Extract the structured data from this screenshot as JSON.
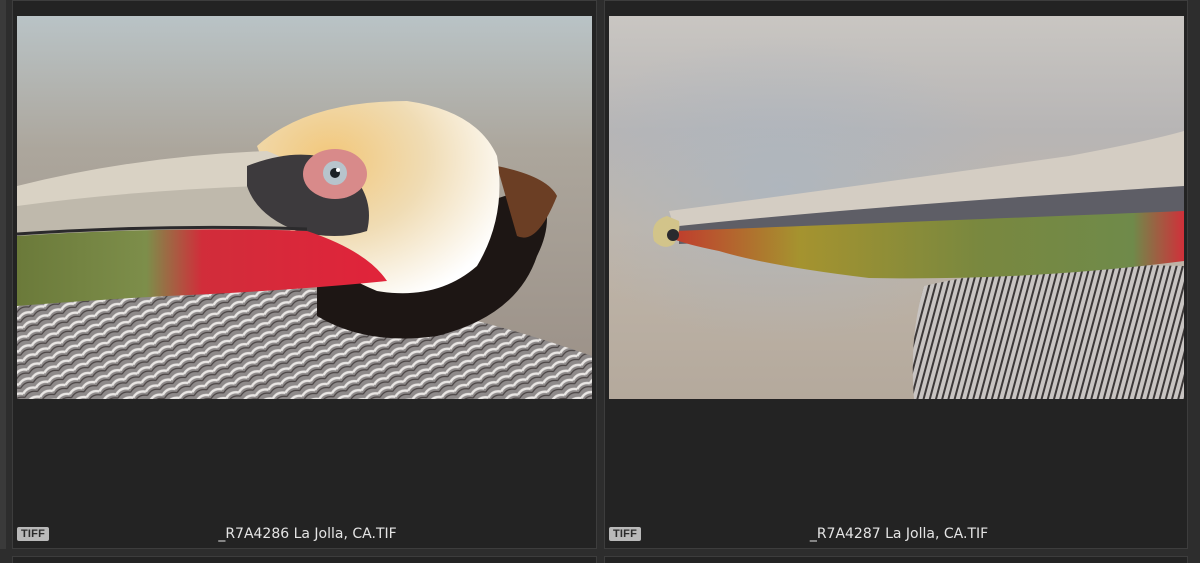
{
  "grid": {
    "cells": [
      {
        "badge": "TIFF",
        "filename": "_R7A4286 La Jolla, CA.TIF",
        "thumbnail": "pelican-head-closeup"
      },
      {
        "badge": "TIFF",
        "filename": "_R7A4287 La Jolla, CA.TIF",
        "thumbnail": "pelican-bill-profile"
      }
    ]
  }
}
